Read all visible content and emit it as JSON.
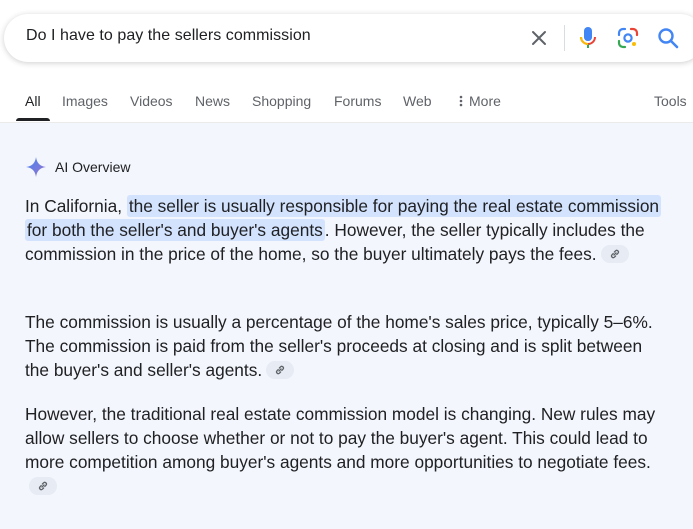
{
  "search": {
    "query": "Do I have to pay the sellers commission"
  },
  "tabs": [
    {
      "label": "All",
      "active": true
    },
    {
      "label": "Images"
    },
    {
      "label": "Videos"
    },
    {
      "label": "News"
    },
    {
      "label": "Shopping"
    },
    {
      "label": "Forums"
    },
    {
      "label": "Web"
    },
    {
      "label": "More"
    }
  ],
  "tools_label": "Tools",
  "ai_overview": {
    "title": "AI Overview",
    "p1": {
      "before": "In California, ",
      "highlight": "the seller is usually responsible for paying the real estate commission for both the seller's and buyer's agents",
      "after": ". However, the seller typically includes the commission in the price of the home, so the buyer ultimately pays the fees."
    },
    "p2": "The commission is usually a percentage of the home's sales price, typically 5–6%. The commission is paid from the seller's proceeds at closing and is split between the buyer's and seller's agents.",
    "p3": "However, the traditional real estate commission model is changing. New rules may allow sellers to choose whether or not to pay the buyer's agent. This could lead to more competition among buyer's agents and more opportunities to negotiate fees."
  },
  "colors": {
    "accent_blue": "#4285f4",
    "highlight": "#d3e3fd",
    "overview_bg": "#f3f6fc"
  }
}
